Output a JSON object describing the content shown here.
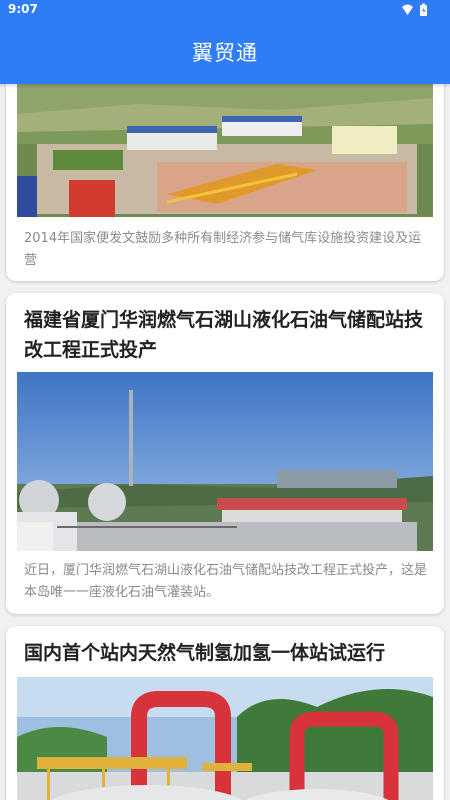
{
  "status_bar": {
    "time": "9:07"
  },
  "app": {
    "title": "翼贸通"
  },
  "articles": [
    {
      "title": "",
      "summary": "2014年国家便发文鼓励多种所有制经济参与储气库设施投资建设及运营"
    },
    {
      "title": "福建省厦门华润燃气石湖山液化石油气储配站技改工程正式投产",
      "summary": "近日，厦门华润燃气石湖山液化石油气储配站技改工程正式投产，这是本岛唯一一座液化石油气灌装站。"
    },
    {
      "title": "国内首个站内天然气制氢加氢一体站试运行",
      "summary": ""
    }
  ],
  "colors": {
    "primary": "#2f7df6",
    "card": "#ffffff",
    "background": "#f1f1f1",
    "caption": "#8a8a8a"
  }
}
